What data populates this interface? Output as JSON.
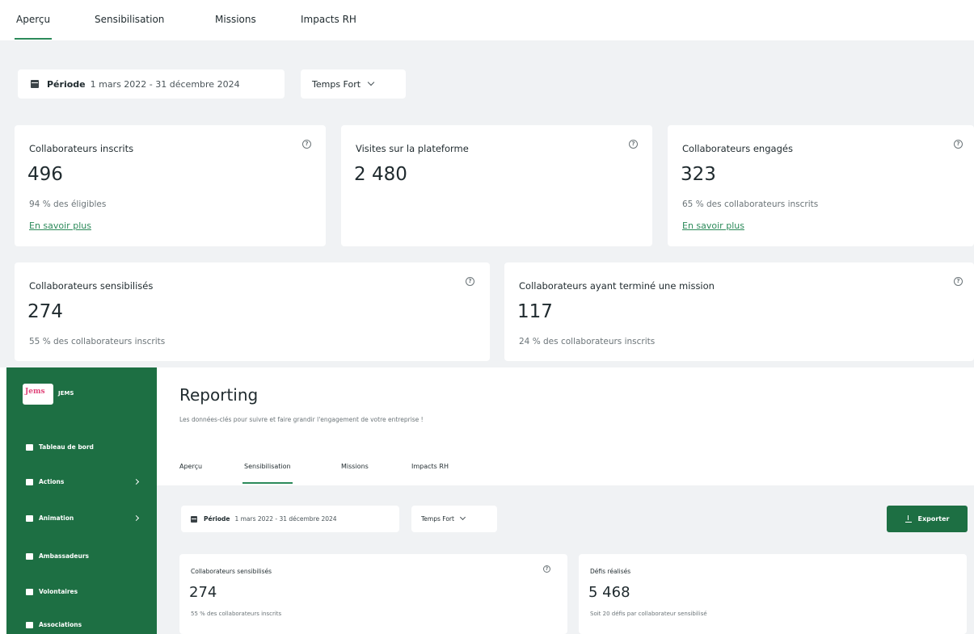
{
  "top": {
    "tabs": [
      "Aperçu",
      "Sensibilisation",
      "Missions",
      "Impacts RH"
    ],
    "active_tab": "Aperçu",
    "period_label": "Période",
    "period_value": "1 mars 2022 - 31 décembre 2024",
    "filter_label": "Temps Fort",
    "cards": [
      {
        "title": "Collaborateurs inscrits",
        "value": "496",
        "sub": "94 % des éligibles",
        "link": "En savoir plus"
      },
      {
        "title": "Visites sur la plateforme",
        "value": "2 480"
      },
      {
        "title": "Collaborateurs engagés",
        "value": "323",
        "sub": "65 % des collaborateurs inscrits",
        "link": "En savoir plus"
      },
      {
        "title": "Collaborateurs sensibilisés",
        "value": "274",
        "sub": "55 % des collaborateurs inscrits"
      },
      {
        "title": "Collaborateurs ayant terminé une mission",
        "value": "117",
        "sub": "24 % des collaborateurs inscrits"
      }
    ]
  },
  "sidebar": {
    "logo_text": "Jems",
    "brand": "JEMS",
    "items": [
      {
        "label": "Tableau de bord",
        "icon": "dashboard-icon"
      },
      {
        "label": "Actions",
        "icon": "actions-icon",
        "has_submenu": true
      },
      {
        "label": "Animation",
        "icon": "animation-icon",
        "has_submenu": true
      },
      {
        "label": "Ambassadeurs",
        "icon": "ambassadors-icon"
      },
      {
        "label": "Volontaires",
        "icon": "volunteers-icon"
      },
      {
        "label": "Associations",
        "icon": "associations-icon"
      }
    ]
  },
  "main": {
    "title": "Reporting",
    "subtitle": "Les données-clés pour suivre et faire grandir l'engagement de votre entreprise !",
    "tabs": [
      "Aperçu",
      "Sensibilisation",
      "Missions",
      "Impacts RH"
    ],
    "active_tab": "Sensibilisation",
    "period_label": "Période",
    "period_value": "1 mars 2022 - 31 décembre 2024",
    "filter_label": "Temps Fort",
    "export_label": "Exporter",
    "cards": [
      {
        "title": "Collaborateurs sensibilisés",
        "value": "274",
        "sub": "55 % des collaborateurs inscrits"
      },
      {
        "title": "Défis réalisés",
        "value": "5 468",
        "sub": "Soit 20 défis par collaborateur sensibilisé"
      }
    ]
  },
  "colors": {
    "accent": "#2c8a5a",
    "sidebar": "#1d6f43",
    "background": "#f0f2f4"
  }
}
